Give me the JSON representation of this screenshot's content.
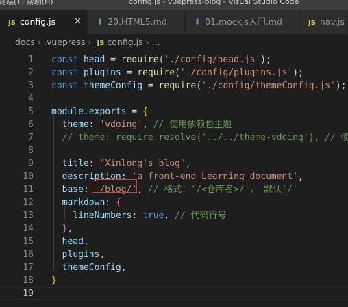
{
  "titlebar": {
    "menu": "终端(T)  帮助(H)",
    "window_title": "config.js - vuepress-blog - Visual Studio Code"
  },
  "tabs": [
    {
      "icon": "JS",
      "label": "config.js",
      "close": "✕",
      "active": true
    },
    {
      "icon": "⬇",
      "label": "20.HTML5.md"
    },
    {
      "icon": "⬇",
      "label": "01.mockjs入门.md"
    },
    {
      "icon": "JS",
      "label": "nav.js"
    }
  ],
  "breadcrumb": {
    "items": [
      "docs",
      ".vuepress",
      "config.js",
      "..."
    ],
    "separator": "›",
    "file_icon": "JS"
  },
  "editor": {
    "current_line": 19,
    "lines": [
      {
        "n": "1",
        "t": [
          [
            "kw",
            "const "
          ],
          [
            "var",
            "head"
          ],
          [
            "pun",
            " = "
          ],
          [
            "fn",
            "require"
          ],
          [
            "pun",
            "("
          ],
          [
            "str",
            "'./config/head.js'"
          ],
          [
            "pun",
            ");"
          ]
        ]
      },
      {
        "n": "2",
        "t": [
          [
            "kw",
            "const "
          ],
          [
            "var",
            "plugins"
          ],
          [
            "pun",
            " = "
          ],
          [
            "fn",
            "require"
          ],
          [
            "pun",
            "("
          ],
          [
            "str",
            "'./config/plugins.js'"
          ],
          [
            "pun",
            ");"
          ]
        ]
      },
      {
        "n": "3",
        "t": [
          [
            "kw",
            "const "
          ],
          [
            "var",
            "themeConfig"
          ],
          [
            "pun",
            " = "
          ],
          [
            "fn",
            "require"
          ],
          [
            "pun",
            "("
          ],
          [
            "str",
            "'./config/themeConfig.js'"
          ],
          [
            "pun",
            ");"
          ]
        ]
      },
      {
        "n": "4",
        "t": []
      },
      {
        "n": "5",
        "t": [
          [
            "var",
            "module"
          ],
          [
            "pun",
            "."
          ],
          [
            "var",
            "exports"
          ],
          [
            "pun",
            " = "
          ],
          [
            "br1",
            "{"
          ]
        ]
      },
      {
        "n": "6",
        "t": [
          [
            "pun",
            "  "
          ],
          [
            "var",
            "theme"
          ],
          [
            "pun",
            ": "
          ],
          [
            "str",
            "'vdoing'"
          ],
          [
            "pun",
            ", "
          ],
          [
            "cm",
            "// 使用依赖包主题"
          ]
        ]
      },
      {
        "n": "7",
        "t": [
          [
            "pun",
            "  "
          ],
          [
            "cm",
            "// theme: require.resolve('../../theme-vdoing'), // 使用"
          ]
        ]
      },
      {
        "n": "8",
        "t": []
      },
      {
        "n": "9",
        "t": [
          [
            "pun",
            "  "
          ],
          [
            "var",
            "title"
          ],
          [
            "pun",
            ": "
          ],
          [
            "str",
            "\"Xinlong's blog\""
          ],
          [
            "pun",
            ","
          ]
        ]
      },
      {
        "n": "10",
        "t": [
          [
            "pun",
            "  "
          ],
          [
            "var",
            "description"
          ],
          [
            "pun",
            ": "
          ],
          [
            "str",
            "'a front-end Learning document'"
          ],
          [
            "pun",
            ","
          ]
        ]
      },
      {
        "n": "11",
        "t": [
          [
            "pun",
            "  "
          ],
          [
            "var",
            "base"
          ],
          [
            "pun",
            ": "
          ],
          [
            "str",
            "'/blog/'"
          ],
          [
            "pun",
            ", "
          ],
          [
            "cm",
            "// 格式：'/<仓库名>/'， 默认'/'"
          ]
        ]
      },
      {
        "n": "12",
        "t": [
          [
            "pun",
            "  "
          ],
          [
            "var",
            "markdown"
          ],
          [
            "pun",
            ": "
          ],
          [
            "br2",
            "{"
          ]
        ]
      },
      {
        "n": "13",
        "t": [
          [
            "pun",
            "    "
          ],
          [
            "var",
            "lineNumbers"
          ],
          [
            "pun",
            ": "
          ],
          [
            "kw",
            "true"
          ],
          [
            "pun",
            ", "
          ],
          [
            "cm",
            "// 代码行号"
          ]
        ]
      },
      {
        "n": "14",
        "t": [
          [
            "pun",
            "  "
          ],
          [
            "br2",
            "}"
          ],
          [
            "pun",
            ","
          ]
        ]
      },
      {
        "n": "15",
        "t": [
          [
            "pun",
            "  "
          ],
          [
            "var",
            "head"
          ],
          [
            "pun",
            ","
          ]
        ]
      },
      {
        "n": "16",
        "t": [
          [
            "pun",
            "  "
          ],
          [
            "var",
            "plugins"
          ],
          [
            "pun",
            ","
          ]
        ]
      },
      {
        "n": "17",
        "t": [
          [
            "pun",
            "  "
          ],
          [
            "var",
            "themeConfig"
          ],
          [
            "pun",
            ","
          ]
        ]
      },
      {
        "n": "18",
        "t": [
          [
            "br1",
            "}"
          ]
        ]
      },
      {
        "n": "19",
        "t": []
      }
    ]
  },
  "colors": {
    "keyword": "#569cd6",
    "variable": "#9cdcfe",
    "function": "#dcdcaa",
    "string": "#ce9178",
    "comment": "#6a9955",
    "punctuation": "#d4d4d4",
    "bracket_level1": "#ffd700",
    "bracket_level2": "#da70d6",
    "highlight_box": "#e03a3a"
  }
}
